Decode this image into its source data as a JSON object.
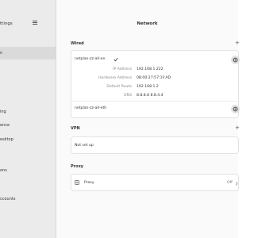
{
  "sidebar": {
    "title": "ttings",
    "items": [
      {
        "label": "n",
        "selected": true
      },
      {
        "label": "ing",
        "selected": false
      },
      {
        "label": "ence",
        "selected": false
      },
      {
        "label": "esktop",
        "selected": false
      },
      {
        "label": "ons",
        "selected": false
      },
      {
        "label": "ccounts",
        "selected": false
      }
    ]
  },
  "main": {
    "title": "Network",
    "wired": {
      "label": "Wired",
      "connection1": {
        "name": "netplan-zz-all-en",
        "details": [
          {
            "label": "IP Address",
            "value": "192.168.1.222"
          },
          {
            "label": "Hardware Address",
            "value": "08:00:27:57:1F:AD"
          },
          {
            "label": "Default Route",
            "value": "192.168.1.2"
          },
          {
            "label": "DNS",
            "value": "8.8.8.8 8.8.4.4"
          }
        ]
      },
      "connection2": {
        "name": "netplan-zz-all-eth"
      }
    },
    "vpn": {
      "label": "VPN",
      "status": "Not set up"
    },
    "proxy": {
      "label": "Proxy",
      "row_label": "Proxy",
      "state": "Off"
    }
  },
  "icons": {
    "hamburger": "hamburger-menu-icon",
    "check": "check-icon",
    "gear": "gear-icon",
    "plus": "plus-icon",
    "proxy": "proxy-network-icon",
    "chevron": "chevron-right-icon"
  }
}
